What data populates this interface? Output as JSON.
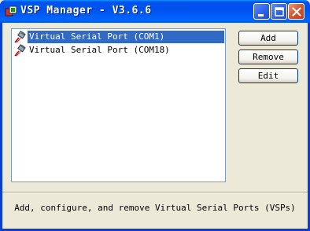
{
  "window": {
    "title": "VSP Manager - V3.6.6",
    "icon": "app-icon",
    "controls": [
      "minimize-icon",
      "maximize-icon",
      "close-icon"
    ]
  },
  "ports": [
    {
      "label": "Virtual Serial Port (COM1)",
      "selected": true,
      "icon": "serial-plug-icon"
    },
    {
      "label": "Virtual Serial Port (COM18)",
      "selected": false,
      "icon": "serial-plug-icon"
    }
  ],
  "buttons": {
    "add": "Add",
    "remove": "Remove",
    "edit": "Edit"
  },
  "status": {
    "text": "Add, configure, and remove Virtual Serial Ports (VSPs)"
  },
  "colors": {
    "titlebar": "#0053ee",
    "selection": "#316ac5",
    "face": "#ece9d8"
  }
}
